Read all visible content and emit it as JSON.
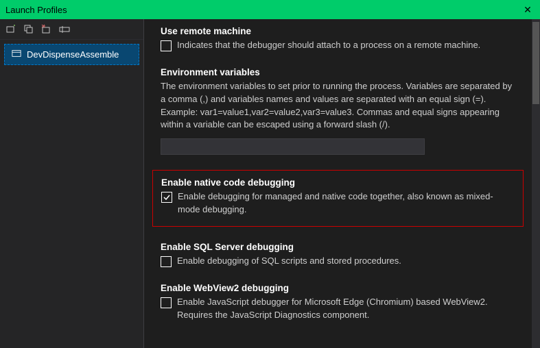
{
  "window": {
    "title": "Launch Profiles"
  },
  "sidebar": {
    "profiles": [
      {
        "label": "DevDispenseAssemble"
      }
    ]
  },
  "icons": {
    "new_profile": "new-profile-icon",
    "duplicate": "duplicate-icon",
    "delete": "delete-icon",
    "rename": "rename-icon",
    "project": "project-icon"
  },
  "sections": {
    "remote": {
      "title": "Use remote machine",
      "checkbox_label": "Indicates that the debugger should attach to a process on a remote machine.",
      "checked": false
    },
    "env": {
      "title": "Environment variables",
      "desc": "The environment variables to set prior to running the process. Variables are separated by a comma (,) and variables names and values are separated with an equal sign (=). Example: var1=value1,var2=value2,var3=value3. Commas and equal signs appearing within a variable can be escaped using a forward slash (/).",
      "value": ""
    },
    "native": {
      "title": "Enable native code debugging",
      "checkbox_label": "Enable debugging for managed and native code together, also known as mixed-mode debugging.",
      "checked": true
    },
    "sql": {
      "title": "Enable SQL Server debugging",
      "checkbox_label": "Enable debugging of SQL scripts and stored procedures.",
      "checked": false
    },
    "webview": {
      "title": "Enable WebView2 debugging",
      "checkbox_label": "Enable JavaScript debugger for Microsoft Edge (Chromium) based WebView2. Requires the JavaScript Diagnostics component.",
      "checked": false
    }
  }
}
